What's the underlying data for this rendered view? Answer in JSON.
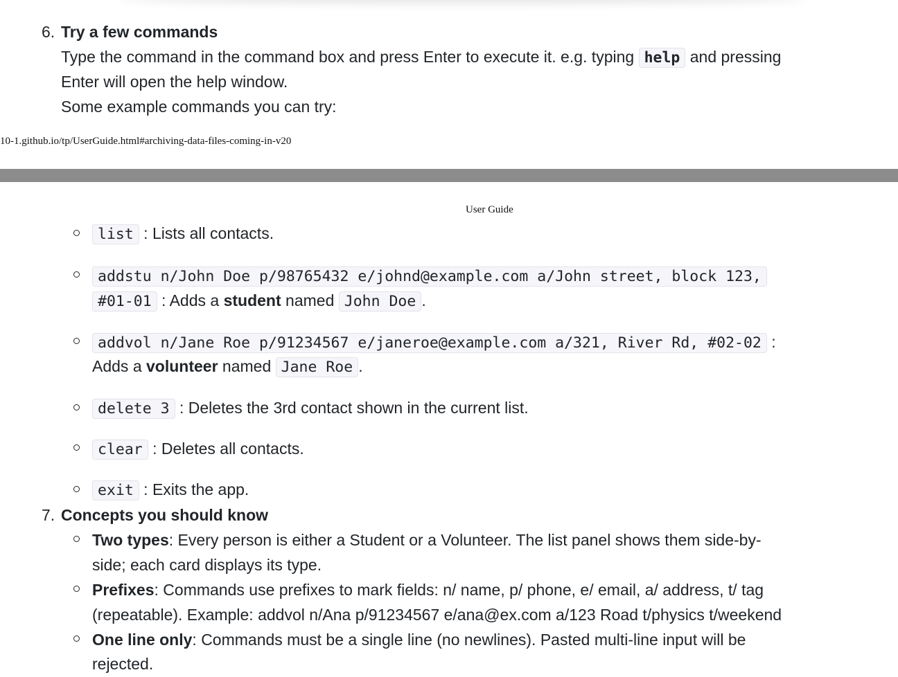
{
  "step6": {
    "number": "6.",
    "heading": "Try a few commands",
    "line1_before": "Type the command in the command box and press Enter to execute it. e.g. typing ",
    "line1_code": "help",
    "line1_after": " and pressing",
    "line2": "Enter will open the help window.",
    "line3": "Some example commands you can try:"
  },
  "print": {
    "footer_url": "10-1.github.io/tp/UserGuide.html#archiving-data-files-coming-in-v20",
    "header_title": "User Guide"
  },
  "commands": {
    "list_code": "list",
    "list_desc": " : Lists all contacts.",
    "addstu_code_l1": "addstu n/John Doe p/98765432 e/johnd@example.com a/John street, block 123,",
    "addstu_code_l2": "#01-01",
    "addstu_mid1": " : Adds a ",
    "addstu_bold": "student",
    "addstu_mid2": " named ",
    "addstu_name": "John Doe",
    "addstu_end": ".",
    "addvol_code": "addvol n/Jane Roe p/91234567 e/janeroe@example.com a/321, River Rd, #02-02",
    "addvol_colon": " :",
    "addvol_mid1": "Adds a ",
    "addvol_bold": "volunteer",
    "addvol_mid2": " named ",
    "addvol_name": "Jane Roe",
    "addvol_end": ".",
    "delete_code": "delete 3",
    "delete_desc": " : Deletes the 3rd contact shown in the current list.",
    "clear_code": "clear",
    "clear_desc": " : Deletes all contacts.",
    "exit_code": "exit",
    "exit_desc": " : Exits the app."
  },
  "step7": {
    "number": "7.",
    "heading": "Concepts you should know",
    "types_bold": "Two types",
    "types_l1": ": Every person is either a Student or a Volunteer. The list panel shows them side-by-",
    "types_l2": "side; each card displays its type.",
    "prefixes_bold": "Prefixes",
    "prefixes_l1": ": Commands use prefixes to mark fields: n/ name, p/ phone, e/ email, a/ address, t/ tag",
    "prefixes_l2": "(repeatable). Example: addvol n/Ana p/91234567 e/ana@ex.com a/123 Road t/physics t/weekend",
    "oneline_bold": "One line only",
    "oneline_l1": ": Commands must be a single line (no newlines). Pasted multi-line input will be",
    "oneline_l2": "rejected."
  }
}
